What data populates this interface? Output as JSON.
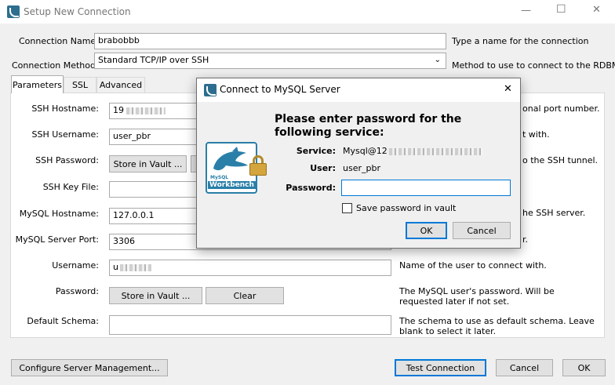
{
  "window": {
    "title": "Setup New Connection",
    "controls": [
      "—",
      "☐",
      "✕"
    ]
  },
  "header": {
    "connection_name_label": "Connection Name:",
    "connection_name_value": "brabobbb",
    "connection_name_hint": "Type a name for the connection",
    "connection_method_label": "Connection Method:",
    "connection_method_value": "Standard TCP/IP over SSH",
    "connection_method_hint": "Method to use to connect to the RDBMS"
  },
  "tabs": [
    {
      "label": "Parameters"
    },
    {
      "label": "SSL"
    },
    {
      "label": "Advanced"
    }
  ],
  "params": {
    "ssh_hostname_label": "SSH Hostname:",
    "ssh_hostname_value": "19",
    "ssh_hostname_hint": "onal port number.",
    "ssh_username_label": "SSH Username:",
    "ssh_username_value": "user_pbr",
    "ssh_username_hint": "t with.",
    "ssh_password_label": "SSH Password:",
    "ssh_store_vault": "Store in Vault ...",
    "ssh_password_hint": "o the SSH tunnel.",
    "ssh_keyfile_label": "SSH Key File:",
    "mysql_hostname_label": "MySQL Hostname:",
    "mysql_hostname_value": "127.0.0.1",
    "mysql_hostname_hint": "he SSH server.",
    "mysql_port_label": "MySQL Server Port:",
    "mysql_port_value": "3306",
    "mysql_port_hint": "r.",
    "username_label": "Username:",
    "username_value": "u",
    "username_hint": "Name of the user to connect with.",
    "password_label": "Password:",
    "store_vault": "Store in Vault ...",
    "clear": "Clear",
    "password_hint": "The MySQL user's password. Will be requested later if not set.",
    "schema_label": "Default Schema:",
    "schema_value": "",
    "schema_hint": "The schema to use as default schema. Leave blank to select it later."
  },
  "footer": {
    "configure": "Configure Server Management...",
    "test": "Test Connection",
    "cancel": "Cancel",
    "ok": "OK"
  },
  "dialog": {
    "title": "Connect to MySQL Server",
    "close": "✕",
    "heading": "Please enter password for the following service:",
    "service_label": "Service:",
    "service_value": "Mysql@12",
    "user_label": "User:",
    "user_value": "user_pbr",
    "password_label": "Password:",
    "password_value": "",
    "save_vault_label": "Save password in vault",
    "ok": "OK",
    "cancel": "Cancel",
    "logo_text_small": "MySQL",
    "logo_text": "Workbench"
  },
  "colors": {
    "accent": "#0078d7",
    "logo_blue": "#2a7fa8",
    "lock_gold": "#d4a53c"
  }
}
